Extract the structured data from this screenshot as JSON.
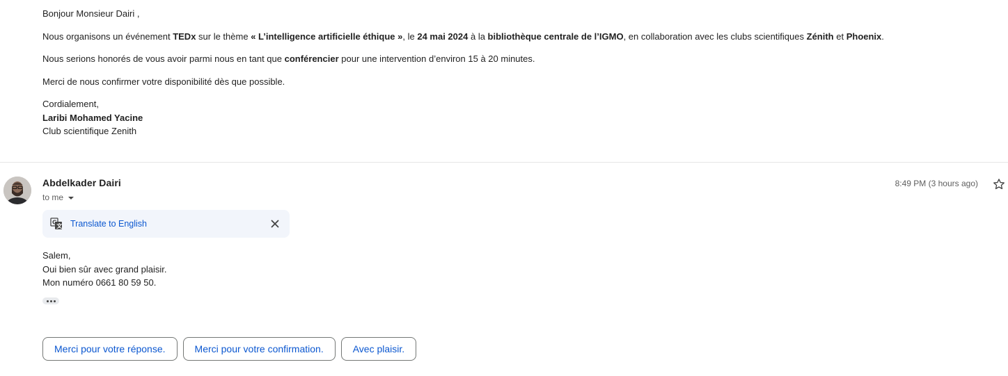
{
  "previous_message": {
    "greeting": "Bonjour Monsieur Dairi ,",
    "para1": {
      "t1": "Nous organisons un événement ",
      "b1": "TEDx",
      "t2": " sur le thème ",
      "b2": "« L’intelligence artificielle éthique »",
      "t3": ", le ",
      "b3": "24 mai 2024",
      "t4": " à la ",
      "b4": "bibliothèque centrale de l’IGMO",
      "t5": ", en collaboration avec les clubs scientifiques ",
      "b5": "Zénith",
      "t6": " et ",
      "b6": "Phoenix",
      "t7": "."
    },
    "para2": {
      "t1": "Nous serions honorés de vous avoir parmi nous en tant que ",
      "b1": "conférencier",
      "t2": " pour une intervention d’environ 15 à 20 minutes."
    },
    "para3": "Merci de nous confirmer votre disponibilité dès que possible.",
    "closing": "Cordialement,",
    "signature_name": "Laribi Mohamed Yacine",
    "signature_org": "Club scientifique Zenith"
  },
  "reply_message": {
    "sender_name": "Abdelkader Dairi",
    "recipient": "to me",
    "timestamp": "8:49 PM (3 hours ago)",
    "translate_label": "Translate to English",
    "body": [
      "Salem,",
      "Oui bien sûr avec grand plaisir.",
      "Mon numéro 0661 80 59 50."
    ]
  },
  "smart_replies": [
    "Merci pour votre réponse.",
    "Merci pour votre confirmation.",
    "Avec plaisir."
  ],
  "icons": {
    "avatar": "avatar",
    "star": "star-icon",
    "translate": "translate-icon",
    "close": "close-icon",
    "caret": "chevron-down-icon",
    "ellipsis": "more-horizontal-icon"
  },
  "colors": {
    "link": "#0b57d0",
    "translate_bg": "#f2f5fb",
    "divider": "#e5e5e5"
  }
}
